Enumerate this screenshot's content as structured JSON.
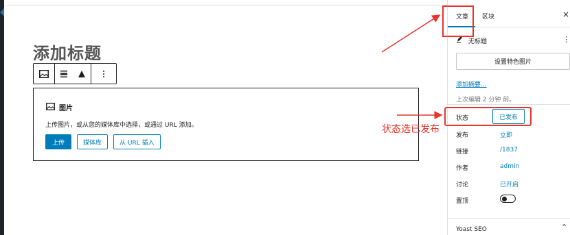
{
  "editor": {
    "post_title": "添加标题",
    "toolbar": {
      "icons": [
        "image-icon",
        "align-center-icon",
        "warning-triangle-icon",
        "more-vertical-icon"
      ]
    },
    "image_block": {
      "title": "图片",
      "description": "上传图片，或从您的媒体库中选择，或通过 URL 添加。",
      "upload_label": "上传",
      "media_library_label": "媒体库",
      "insert_url_label": "从 URL 插入"
    }
  },
  "annotation": {
    "text": "状态选已发布",
    "color": "#e8342c"
  },
  "sidebar": {
    "tabs": [
      {
        "label": "文章",
        "active": true
      },
      {
        "label": "区块",
        "active": false
      }
    ],
    "close_label": "×",
    "post_title": "无标题",
    "more_label": "⋮",
    "featured_image_label": "设置特色图片",
    "excerpt_link": "添加摘要...",
    "last_edited": "上次编辑 2 分钟 前。",
    "rows": [
      {
        "label": "状态",
        "value": "已发布"
      },
      {
        "label": "发布",
        "value": "立即"
      },
      {
        "label": "链接",
        "value": "/1837"
      },
      {
        "label": "作者",
        "value": "admin"
      },
      {
        "label": "讨论",
        "value": "已开启"
      },
      {
        "label": "置顶",
        "value": ""
      }
    ],
    "sticky_toggle_on": false,
    "yoast_label": "Yoast SEO",
    "yoast_chevron": "⌃"
  },
  "colors": {
    "accent": "#007cba",
    "annotation_red": "#e8342c"
  }
}
